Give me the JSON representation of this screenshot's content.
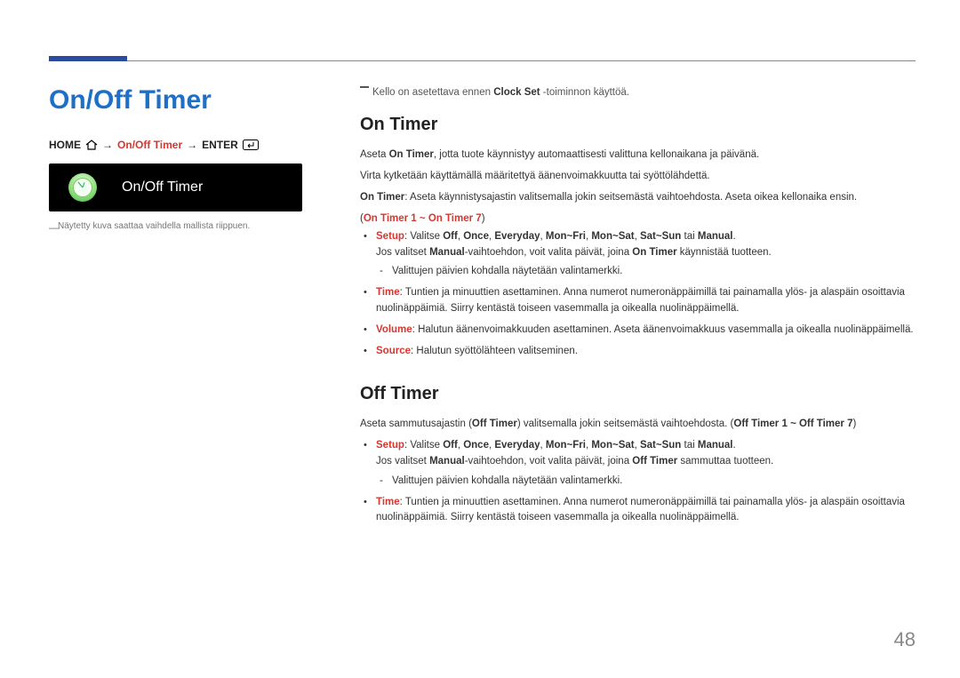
{
  "page_number": "48",
  "left": {
    "title": "On/Off Timer",
    "nav": {
      "home": "HOME",
      "arrow": "→",
      "path": "On/Off Timer",
      "enter": "ENTER"
    },
    "screenshot_label": "On/Off Timer",
    "footnote_dash": "―",
    "footnote": "Näytetty kuva saattaa vaihdella mallista riippuen."
  },
  "right": {
    "pre_note_prefix": "Kello on asetettava ennen ",
    "pre_note_bold": "Clock Set",
    "pre_note_suffix": " -toiminnon käyttöä.",
    "on_timer": {
      "heading": "On Timer",
      "p1_a": "Aseta ",
      "p1_b": "On Timer",
      "p1_c": ", jotta tuote käynnistyy automaattisesti valittuna kellonaikana ja päivänä.",
      "p2": "Virta kytketään käyttämällä määritettyä äänenvoimakkuutta tai syöttölähdettä.",
      "p3_a": "On Timer",
      "p3_b": ": Aseta käynnistysajastin valitsemalla jokin seitsemästä vaihtoehdosta. Aseta oikea kellonaika ensin.",
      "range_open": "(",
      "range": "On Timer 1 ~ On Timer 7",
      "range_close": ")",
      "setup": {
        "label": "Setup",
        "text_a": ": Valitse ",
        "opts": [
          "Off",
          "Once",
          "Everyday",
          "Mon~Fri",
          "Mon~Sat",
          "Sat~Sun"
        ],
        "tai": " tai ",
        "manual": "Manual",
        "period": ".",
        "line2_a": "Jos valitset ",
        "line2_b": "Manual",
        "line2_c": "-vaihtoehdon, voit valita päivät, joina ",
        "line2_d": "On Timer",
        "line2_e": " käynnistää tuotteen.",
        "sub1": "Valittujen päivien kohdalla näytetään valintamerkki."
      },
      "time": {
        "label": "Time",
        "text": ": Tuntien ja minuuttien asettaminen. Anna numerot numeronäppäimillä tai painamalla ylös- ja alaspäin osoittavia nuolinäppäimiä. Siirry kentästä toiseen vasemmalla ja oikealla nuolinäppäimellä."
      },
      "volume": {
        "label": "Volume",
        "text": ": Halutun äänenvoimakkuuden asettaminen. Aseta äänenvoimakkuus vasemmalla ja oikealla nuolinäppäimellä."
      },
      "source": {
        "label": "Source",
        "text": ": Halutun syöttölähteen valitseminen."
      }
    },
    "off_timer": {
      "heading": "Off Timer",
      "p1_a": "Aseta sammutusajastin (",
      "p1_b": "Off Timer",
      "p1_c": ") valitsemalla jokin seitsemästä vaihtoehdosta. (",
      "p1_d": "Off Timer 1 ~ Off Timer 7",
      "p1_e": ")",
      "setup": {
        "label": "Setup",
        "text_a": ": Valitse ",
        "opts": [
          "Off",
          "Once",
          "Everyday",
          "Mon~Fri",
          "Mon~Sat",
          "Sat~Sun"
        ],
        "tai": " tai ",
        "manual": "Manual",
        "period": ".",
        "line2_a": "Jos valitset ",
        "line2_b": "Manual",
        "line2_c": "-vaihtoehdon, voit valita päivät, joina ",
        "line2_d": "Off Timer",
        "line2_e": " sammuttaa tuotteen.",
        "sub1": "Valittujen päivien kohdalla näytetään valintamerkki."
      },
      "time": {
        "label": "Time",
        "text": ": Tuntien ja minuuttien asettaminen. Anna numerot numeronäppäimillä tai painamalla ylös- ja alaspäin osoittavia nuolinäppäimiä. Siirry kentästä toiseen vasemmalla ja oikealla nuolinäppäimellä."
      }
    }
  }
}
